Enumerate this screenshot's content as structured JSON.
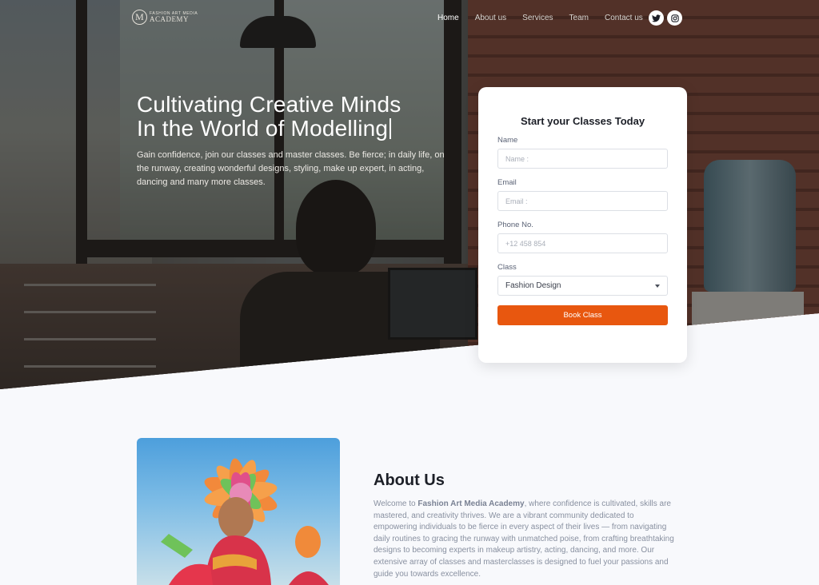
{
  "brand": {
    "logo_letter": "M",
    "logo_small": "FASHION ART MEDIA",
    "logo_big": "ACADEMY"
  },
  "nav": {
    "items": [
      "Home",
      "About us",
      "Services",
      "Team",
      "Contact us"
    ]
  },
  "social": {
    "icons": [
      "twitter-icon",
      "instagram-icon"
    ]
  },
  "hero": {
    "title_line1": "Cultivating Creative Minds",
    "title_line2": "In the World of Modelling",
    "description": "Gain confidence, join our classes and master classes. Be fierce; in daily life, on the runway, creating wonderful designs, styling, make up expert, in acting, dancing and many more classes."
  },
  "form": {
    "title": "Start your Classes Today",
    "name_label": "Name",
    "name_placeholder": "Name :",
    "email_label": "Email",
    "email_placeholder": "Email :",
    "phone_label": "Phone No.",
    "phone_placeholder": "+12 458 854",
    "class_label": "Class",
    "class_selected": "Fashion Design",
    "submit_label": "Book Class"
  },
  "about": {
    "title": "About Us",
    "text_prefix": "Welcome to ",
    "brand_name": "Fashion Art Media Academy",
    "text_body": ", where confidence is cultivated, skills are mastered, and creativity thrives. We are a vibrant community dedicated to empowering individuals to be fierce in every aspect of their lives — from navigating daily routines to gracing the runway with unmatched poise, from crafting breathtaking designs to becoming experts in makeup artistry, acting, dancing, and more. Our extensive array of classes and masterclasses is designed to fuel your passions and guide you towards excellence."
  },
  "colors": {
    "accent": "#e8570f",
    "heading": "#1c1f27",
    "background": "#f8f9fc"
  }
}
